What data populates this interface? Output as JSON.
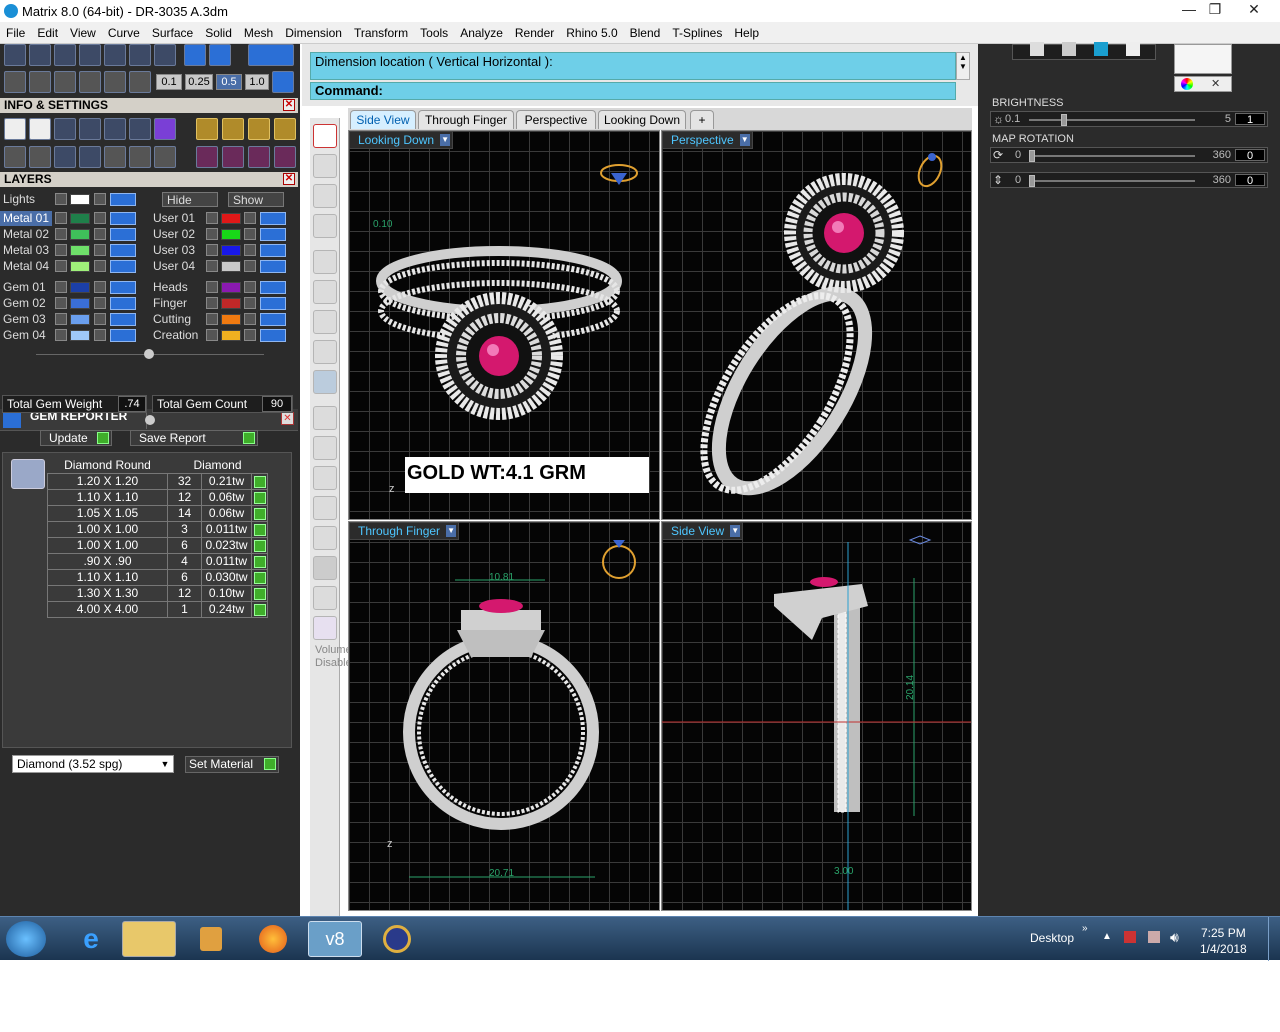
{
  "window": {
    "title": "Matrix 8.0 (64-bit) - DR-3035 A.3dm",
    "min": "—",
    "max": "❐",
    "close": "✕"
  },
  "menu": [
    "File",
    "Edit",
    "View",
    "Curve",
    "Surface",
    "Solid",
    "Mesh",
    "Dimension",
    "Transform",
    "Tools",
    "Analyze",
    "Render",
    "Rhino 5.0",
    "Blend",
    "T-Splines",
    "Help"
  ],
  "snap_values": [
    "0.1",
    "0.25",
    "0.5",
    "1.0"
  ],
  "info_settings": {
    "title": "INFO & SETTINGS"
  },
  "layers": {
    "title": "LAYERS",
    "lights": "Lights",
    "hide": "Hide",
    "show": "Show",
    "left": [
      {
        "name": "Metal 01",
        "color": "#1f7f4a"
      },
      {
        "name": "Metal 02",
        "color": "#3fbf5a"
      },
      {
        "name": "Metal 03",
        "color": "#6fe06a"
      },
      {
        "name": "Metal 04",
        "color": "#9ff07a"
      },
      {
        "name": "Gem 01",
        "color": "#1b3fa8"
      },
      {
        "name": "Gem 02",
        "color": "#3a6ed6"
      },
      {
        "name": "Gem 03",
        "color": "#6a9fee"
      },
      {
        "name": "Gem 04",
        "color": "#9fc8f8"
      }
    ],
    "right": [
      {
        "name": "User 01",
        "color": "#e01818"
      },
      {
        "name": "User 02",
        "color": "#18d818"
      },
      {
        "name": "User 03",
        "color": "#1818e8"
      },
      {
        "name": "User 04",
        "color": "#c8c8c8"
      },
      {
        "name": "Heads",
        "color": "#8a1ab0"
      },
      {
        "name": "Finger",
        "color": "#c02828"
      },
      {
        "name": "Cutting",
        "color": "#f07a10"
      },
      {
        "name": "Creation",
        "color": "#f0b020"
      }
    ]
  },
  "gem_reporter": {
    "title": "GEM REPORTER",
    "total_weight_label": "Total Gem Weight",
    "total_weight": ".74",
    "total_count_label": "Total Gem Count",
    "total_count": "90",
    "update": "Update",
    "save_report": "Save Report",
    "columns": [
      "Diamond Round",
      "Diamond"
    ],
    "rows": [
      {
        "size": "1.20 X 1.20",
        "count": "32",
        "tw": "0.21tw"
      },
      {
        "size": "1.10 X 1.10",
        "count": "12",
        "tw": "0.06tw"
      },
      {
        "size": "1.05 X 1.05",
        "count": "14",
        "tw": "0.06tw"
      },
      {
        "size": "1.00 X 1.00",
        "count": "3",
        "tw": "0.011tw"
      },
      {
        "size": "1.00 X 1.00",
        "count": "6",
        "tw": "0.023tw"
      },
      {
        "size": ".90 X .90",
        "count": "4",
        "tw": "0.011tw"
      },
      {
        "size": "1.10 X 1.10",
        "count": "6",
        "tw": "0.030tw"
      },
      {
        "size": "1.30 X 1.30",
        "count": "12",
        "tw": "0.10tw"
      },
      {
        "size": "4.00 X 4.00",
        "count": "1",
        "tw": "0.24tw"
      }
    ],
    "material": "Diamond    (3.52 spg)",
    "set_material": "Set Material"
  },
  "command": {
    "dimension_prompt": "Dimension location ( Vertical  Horizontal ):",
    "command_label": "Command:"
  },
  "tabs": [
    "Side View",
    "Through Finger",
    "Perspective",
    "Looking Down",
    "+"
  ],
  "viewports": {
    "top_left": "Looking Down",
    "top_right": "Perspective",
    "bottom_left": "Through Finger",
    "bottom_right": "Side View"
  },
  "gold_weight": "GOLD WT:4.1 GRM",
  "dims": {
    "width_top": "10.81",
    "width_bottom": "20.71",
    "height": "20.14",
    "side_bottom": "3.00",
    "lookdown_left": "0.10"
  },
  "volume_disabled": "Volume Disabled",
  "right_panel": {
    "brightness_label": "BRIGHTNESS",
    "brightness": {
      "min": "0.1",
      "max": "5",
      "value": "1",
      "level": 0.2
    },
    "map_rotation_label": "MAP ROTATION",
    "rot1": {
      "min": "0",
      "max": "360",
      "value": "0"
    },
    "rot2": {
      "min": "0",
      "max": "360",
      "value": "0"
    }
  },
  "taskbar": {
    "desktop": "Desktop",
    "time": "7:25 PM",
    "date": "1/4/2018"
  }
}
